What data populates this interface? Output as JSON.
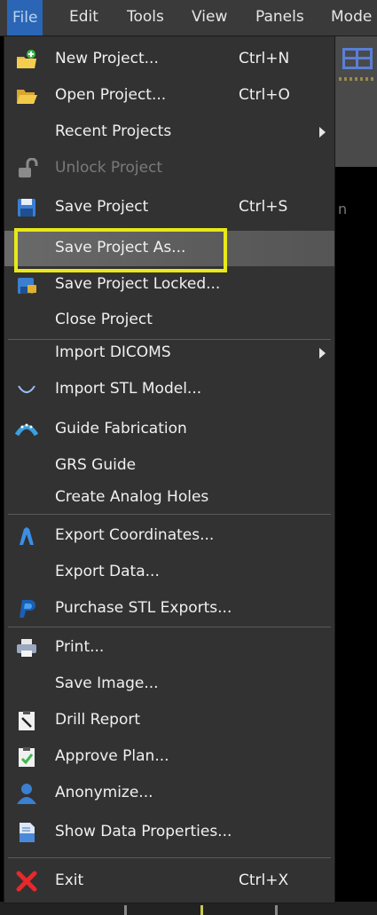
{
  "menubar": {
    "items": [
      "File",
      "Edit",
      "Tools",
      "View",
      "Panels",
      "Mode"
    ]
  },
  "background": {
    "text_fragment": "n"
  },
  "menu": {
    "items": [
      {
        "label": "New Project...",
        "shortcut": "Ctrl+N",
        "icon": "new-project-icon"
      },
      {
        "label": "Open Project...",
        "shortcut": "Ctrl+O",
        "icon": "open-folder-icon"
      },
      {
        "label": "Recent Projects",
        "submenu": true
      },
      {
        "label": "Unlock Project",
        "disabled": true,
        "icon": "unlock-icon"
      },
      {
        "label": "Save Project",
        "shortcut": "Ctrl+S",
        "icon": "floppy-disk-icon"
      },
      {
        "label": "Save Project As...",
        "highlighted": true
      },
      {
        "label": "Save Project Locked...",
        "icon": "save-locked-icon"
      },
      {
        "label": "Close Project"
      },
      {
        "label": "Import DICOMS",
        "submenu": true
      },
      {
        "label": "Import STL Model...",
        "icon": "stl-model-icon"
      },
      {
        "label": "Guide Fabrication",
        "icon": "guide-fabrication-icon"
      },
      {
        "label": "GRS Guide"
      },
      {
        "label": "Create Analog Holes"
      },
      {
        "label": "Export Coordinates...",
        "icon": "export-coordinates-icon"
      },
      {
        "label": "Export Data..."
      },
      {
        "label": "Purchase STL Exports...",
        "icon": "paypal-icon"
      },
      {
        "label": "Print...",
        "icon": "printer-icon"
      },
      {
        "label": "Save Image..."
      },
      {
        "label": "Drill Report",
        "icon": "drill-report-icon"
      },
      {
        "label": "Approve Plan...",
        "icon": "approve-plan-icon"
      },
      {
        "label": "Anonymize...",
        "icon": "user-silhouette-icon"
      },
      {
        "label": "Show Data Properties...",
        "icon": "document-properties-icon"
      },
      {
        "label": "Exit",
        "shortcut": "Ctrl+X",
        "icon": "exit-x-icon"
      }
    ]
  },
  "colors": {
    "menu_background": "#323232",
    "highlight_background": "#5c5c5c",
    "annotation_box": "#e8e81a",
    "active_menubar": "#2a66b5"
  }
}
